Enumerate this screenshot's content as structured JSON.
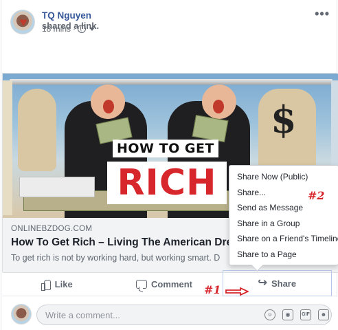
{
  "post": {
    "author": "TQ Nguyen",
    "action": "shared a link.",
    "time": "18 mins",
    "separator": "·",
    "privacy_icon": "globe-icon",
    "more_label": "•••"
  },
  "link": {
    "image_headline_top": "HOW TO GET",
    "image_headline_bottom": "RICH",
    "image_symbol": "$",
    "domain": "ONLINEBZDOG.COM",
    "title": "How To Get Rich – Living The American Dre",
    "description": "To get rich is not by working hard, but working smart. D"
  },
  "actions": {
    "like": "Like",
    "comment": "Comment",
    "share": "Share"
  },
  "share_menu": {
    "items": [
      "Share Now (Public)",
      "Share...",
      "Send as Message",
      "Share in a Group",
      "Share on a Friend's Timeline",
      "Share to a Page"
    ]
  },
  "annotations": {
    "label_1": "#1",
    "label_2": "#2",
    "color": "#d7262c"
  },
  "comment_bar": {
    "placeholder": "Write a comment...",
    "icons": [
      "emoji-icon",
      "camera-icon",
      "gif-icon",
      "sticker-icon"
    ]
  },
  "colors": {
    "link_blue": "#365899",
    "meta_gray": "#616770",
    "rich_red": "#d7262c"
  }
}
